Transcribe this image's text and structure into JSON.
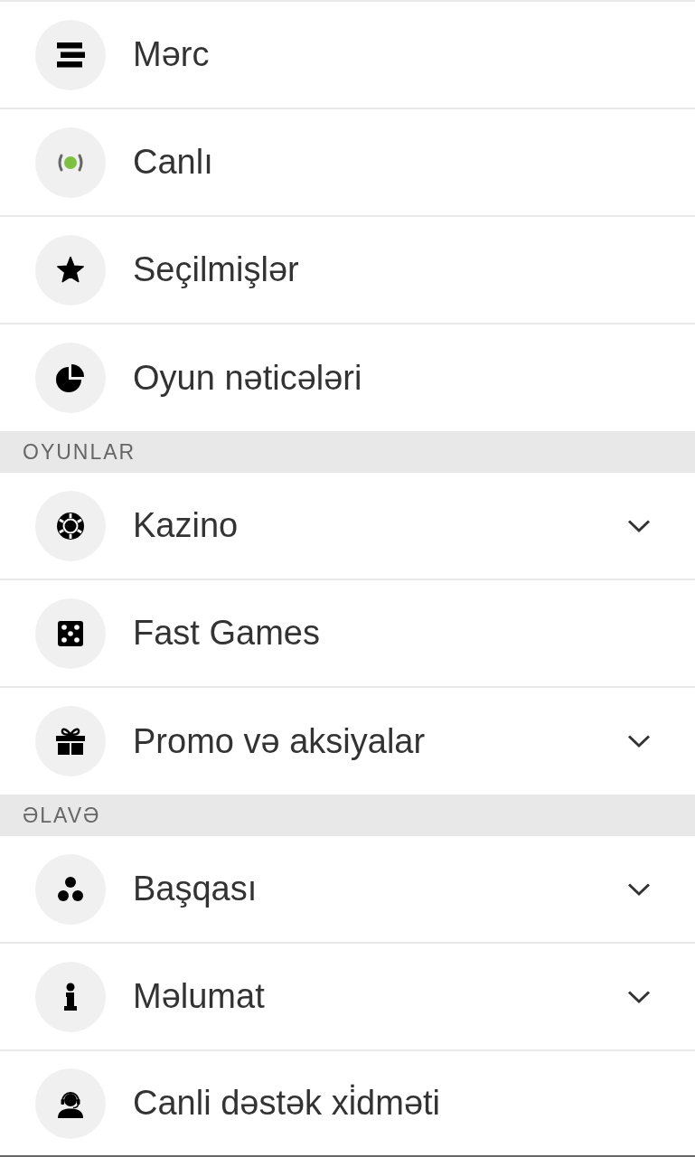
{
  "sections": [
    {
      "items": [
        {
          "label": "Mərc",
          "expandable": false
        },
        {
          "label": "Canlı",
          "expandable": false
        },
        {
          "label": "Seçilmişlər",
          "expandable": false
        },
        {
          "label": "Oyun nəticələri",
          "expandable": false
        }
      ]
    },
    {
      "title": "OYUNLAR",
      "items": [
        {
          "label": "Kazino",
          "expandable": true
        },
        {
          "label": "Fast Games",
          "expandable": false
        },
        {
          "label": "Promo və aksiyalar",
          "expandable": true
        }
      ]
    },
    {
      "title": "ƏLAVƏ",
      "items": [
        {
          "label": "Başqası",
          "expandable": true
        },
        {
          "label": "Məlumat",
          "expandable": true
        },
        {
          "label": "Canli dəstək xi̇dməti",
          "expandable": false
        }
      ]
    }
  ]
}
